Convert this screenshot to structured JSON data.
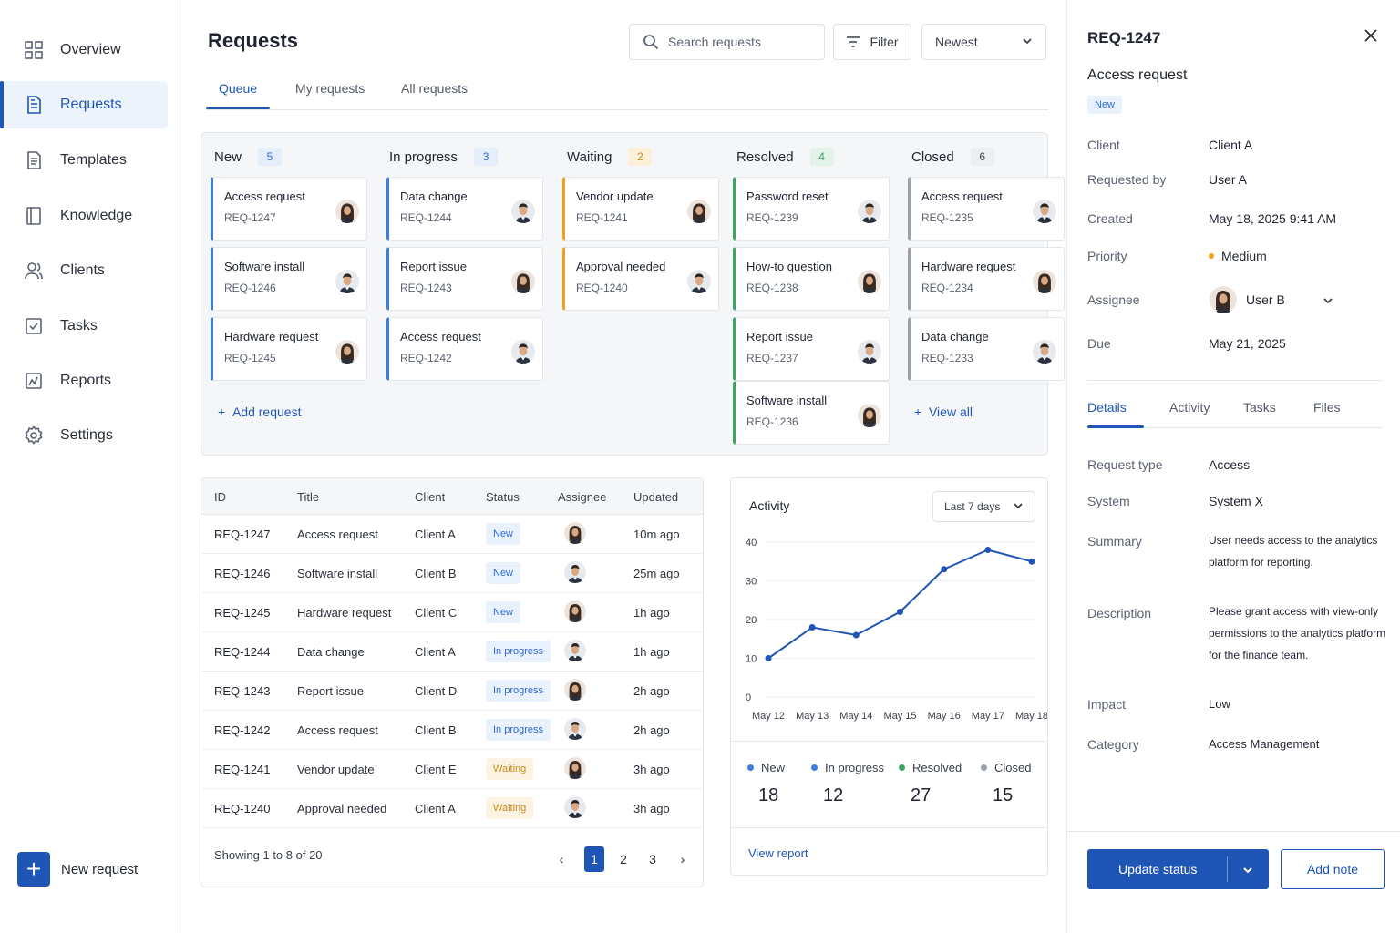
{
  "colors": {
    "accent": "#1f56b5",
    "new": "#3d7de0",
    "in_progress": "#3d7de0",
    "waiting": "#f0a020",
    "resolved": "#3ca565",
    "closed": "#9aa0aa"
  },
  "sidebar": {
    "items": [
      {
        "label": "Overview",
        "icon": "grid-icon"
      },
      {
        "label": "Requests",
        "icon": "document-icon"
      },
      {
        "label": "Templates",
        "icon": "template-icon"
      },
      {
        "label": "Knowledge",
        "icon": "book-icon"
      },
      {
        "label": "Clients",
        "icon": "users-icon"
      },
      {
        "label": "Tasks",
        "icon": "checkbox-icon"
      },
      {
        "label": "Reports",
        "icon": "chart-icon"
      },
      {
        "label": "Settings",
        "icon": "gear-icon"
      }
    ],
    "new_request": "New request"
  },
  "header": {
    "title": "Requests",
    "search_placeholder": "Search requests",
    "filter": "Filter",
    "sort": "Newest",
    "tabs": [
      "Queue",
      "My requests",
      "All requests"
    ]
  },
  "board": {
    "columns": [
      {
        "name": "New",
        "count": "5",
        "cards": [
          {
            "title": "Access request",
            "id": "REQ-1247"
          },
          {
            "title": "Software install",
            "id": "REQ-1246"
          },
          {
            "title": "Hardware request",
            "id": "REQ-1245"
          }
        ]
      },
      {
        "name": "In progress",
        "count": "3",
        "cards": [
          {
            "title": "Data change",
            "id": "REQ-1244"
          },
          {
            "title": "Report issue",
            "id": "REQ-1243"
          },
          {
            "title": "Access request",
            "id": "REQ-1242"
          }
        ]
      },
      {
        "name": "Waiting",
        "count": "2",
        "cards": [
          {
            "title": "Vendor update",
            "id": "REQ-1241"
          },
          {
            "title": "Approval needed",
            "id": "REQ-1240"
          }
        ]
      },
      {
        "name": "Resolved",
        "count": "4",
        "cards": [
          {
            "title": "Password reset",
            "id": "REQ-1239"
          },
          {
            "title": "How-to question",
            "id": "REQ-1238"
          },
          {
            "title": "Report issue",
            "id": "REQ-1237"
          },
          {
            "title": "Software install",
            "id": "REQ-1236"
          }
        ]
      },
      {
        "name": "Closed",
        "count": "6",
        "cards": [
          {
            "title": "Access request",
            "id": "REQ-1235"
          },
          {
            "title": "Hardware request",
            "id": "REQ-1234"
          },
          {
            "title": "Data change",
            "id": "REQ-1233"
          }
        ]
      }
    ],
    "add_request": "Add request",
    "view_all": "View all"
  },
  "table": {
    "headers": [
      "ID",
      "Title",
      "Client",
      "Status",
      "Assignee",
      "Updated"
    ],
    "rows": [
      {
        "id": "REQ-1247",
        "title": "Access request",
        "client": "Client A",
        "status": "New",
        "updated": "10m ago"
      },
      {
        "id": "REQ-1246",
        "title": "Software install",
        "client": "Client B",
        "status": "New",
        "updated": "25m ago"
      },
      {
        "id": "REQ-1245",
        "title": "Hardware request",
        "client": "Client C",
        "status": "New",
        "updated": "1h ago"
      },
      {
        "id": "REQ-1244",
        "title": "Data change",
        "client": "Client A",
        "status": "In progress",
        "updated": "1h ago"
      },
      {
        "id": "REQ-1243",
        "title": "Report issue",
        "client": "Client D",
        "status": "In progress",
        "updated": "2h ago"
      },
      {
        "id": "REQ-1242",
        "title": "Access request",
        "client": "Client B",
        "status": "In progress",
        "updated": "2h ago"
      },
      {
        "id": "REQ-1241",
        "title": "Vendor update",
        "client": "Client E",
        "status": "Waiting",
        "updated": "3h ago"
      },
      {
        "id": "REQ-1240",
        "title": "Approval needed",
        "client": "Client A",
        "status": "Waiting",
        "updated": "3h ago"
      }
    ],
    "footer": "Showing 1 to 8 of 20",
    "pages": [
      "1",
      "2",
      "3"
    ],
    "prev": "‹",
    "next": "›"
  },
  "activity": {
    "title": "Activity",
    "range": "Last 7 days",
    "legend": [
      {
        "label": "New",
        "value": "18",
        "color": "#3d7de0"
      },
      {
        "label": "In progress",
        "value": "12",
        "color": "#3d7de0"
      },
      {
        "label": "Resolved",
        "value": "27",
        "color": "#3ca565"
      },
      {
        "label": "Closed",
        "value": "15",
        "color": "#9aa0aa"
      }
    ],
    "view_report": "View report"
  },
  "chart_data": {
    "type": "line",
    "x": [
      "May 12",
      "May 13",
      "May 14",
      "May 15",
      "May 16",
      "May 17",
      "May 18"
    ],
    "series": [
      {
        "values": [
          10,
          18,
          16,
          22,
          33,
          38,
          35
        ]
      }
    ],
    "yticks": [
      0,
      10,
      20,
      30,
      40
    ],
    "ylim": [
      0,
      40
    ],
    "grid": true,
    "color": "#1f56b5"
  },
  "detail": {
    "id": "REQ-1247",
    "title": "Access request",
    "badge": "New",
    "fields": [
      {
        "label": "Client",
        "value": "Client A"
      },
      {
        "label": "Requested by",
        "value": "User A"
      },
      {
        "label": "Created",
        "value": "May 18, 2025 9:41 AM"
      },
      {
        "label": "Priority",
        "value": "Medium"
      },
      {
        "label": "Assignee",
        "value": "User B"
      },
      {
        "label": "Due",
        "value": "May 21, 2025"
      }
    ],
    "tabs": [
      "Details",
      "Activity",
      "Tasks",
      "Files"
    ],
    "details": [
      {
        "label": "Request type",
        "value": "Access"
      },
      {
        "label": "System",
        "value": "System X"
      },
      {
        "label": "Summary",
        "value": "User needs access to the analytics platform for reporting."
      },
      {
        "label": "Description",
        "value": "Please grant access with view-only permissions to the analytics platform for the finance team."
      },
      {
        "label": "Impact",
        "value": "Low"
      },
      {
        "label": "Category",
        "value": "Access Management"
      }
    ],
    "update_status": "Update status",
    "add_note": "Add note"
  }
}
